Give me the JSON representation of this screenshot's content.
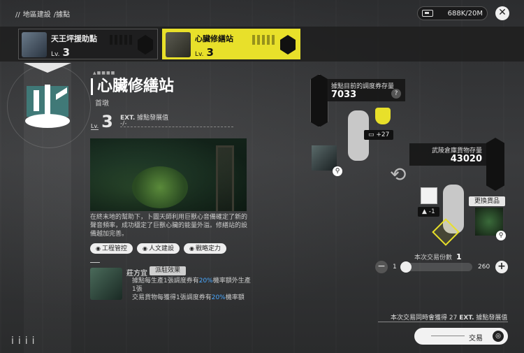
{
  "breadcrumb": {
    "prefix": "//",
    "items": [
      "地區建設",
      "/據點"
    ]
  },
  "currency": {
    "value": "688K/20M",
    "icon": "ticket-icon"
  },
  "tabs": [
    {
      "name": "天王坪援助點",
      "lv_label": "Lv.",
      "level": "3"
    },
    {
      "name": "心臟修繕站",
      "lv_label": "Lv.",
      "level": "3"
    }
  ],
  "station": {
    "title": "心臟修繕站",
    "subtitle": "首墩",
    "lv_label": "Lv.",
    "level": "3",
    "exp_label": "據點發展值",
    "exp_icon": "EXT.",
    "exp_value": "-/-",
    "description": "在終末地的幫助下，卜圖天師利用巨獸心音備確定了新的聲音頻率，成功穩定了巨獸心臟的能量外溢。修繕站的設備越加完善。",
    "chips": [
      "工程管控",
      "人文建設",
      "戰略定力"
    ]
  },
  "operator": {
    "name": "莊方宜",
    "tag": "派駐效果",
    "effect1_a": "據點每生產1張調度券有",
    "effect1_pct": "20%",
    "effect1_b": "機率額外生產1張",
    "effect2_a": "交易貨物每獲得1張調度券有",
    "effect2_pct": "20%",
    "effect2_b": "機率額"
  },
  "trade": {
    "voucher_label": "據點目前的調度券存量",
    "voucher_value": "7033",
    "voucher_gain": "+27",
    "stock_label": "武陵倉庫貨物存量",
    "stock_value": "43020",
    "stock_loss": "-1",
    "swap_label": "更換貨品",
    "qty_label": "本次交易份數",
    "qty_value": "1",
    "min": "1",
    "max": "260",
    "slider_fraction": 0.0,
    "gain_text_a": "本次交易同時會獲得",
    "gain_value": "27",
    "gain_text_b": "據點發展值",
    "trade_button": "交易"
  },
  "colors": {
    "accent": "#e8e02a",
    "highlight": "#4aa8ff"
  }
}
